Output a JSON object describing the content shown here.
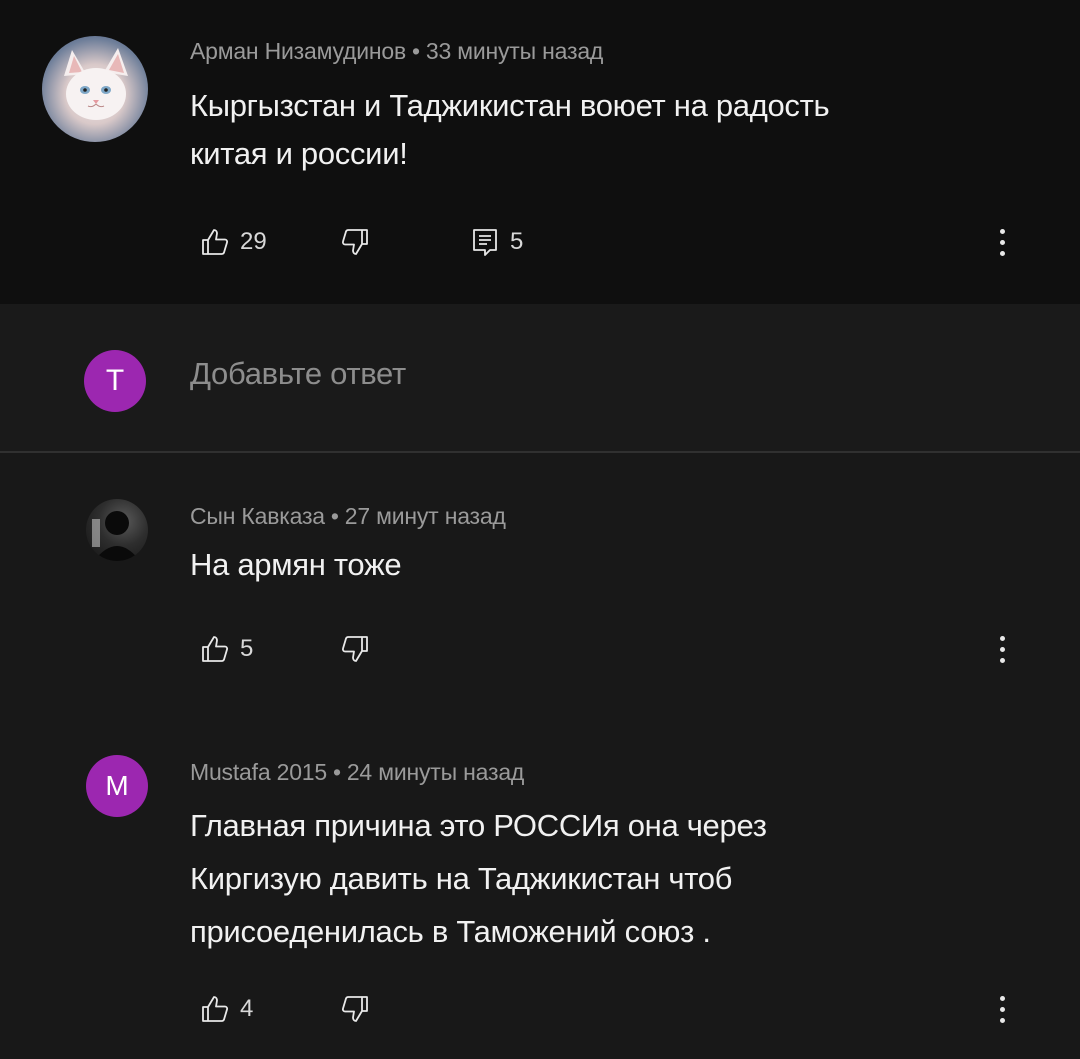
{
  "colors": {
    "background": "#181818",
    "top_comment_bg": "#0f0f0f",
    "meta_text": "#9a9a9a",
    "avatar_purple": "#9c27b0"
  },
  "top_comment": {
    "author": "Арман Низамудинов",
    "time": "33 минуты назад",
    "text_line1": "Кыргызстан и Таджикистан воюет на радость",
    "text_line2": "китая и россии!",
    "likes": "29",
    "replies": "5",
    "avatar_icon": "cat-avatar"
  },
  "reply_box": {
    "avatar_letter": "T",
    "placeholder": "Добавьте ответ"
  },
  "replies": [
    {
      "author": "Сын Кавказа",
      "time": "27 минут назад",
      "text": "На армян тоже",
      "likes": "5",
      "avatar_icon": "person-silhouette-avatar"
    },
    {
      "author": "Mustafa 2015",
      "time": "24 минуты назад",
      "avatar_letter": "M",
      "text_line1": "Главная причина это РОССИя она через",
      "text_line2": "Киргизую давить на Таджикистан чтоб",
      "text_line3": "присоеденилась в Таможений союз .",
      "likes": "4"
    }
  ],
  "separator": "•"
}
